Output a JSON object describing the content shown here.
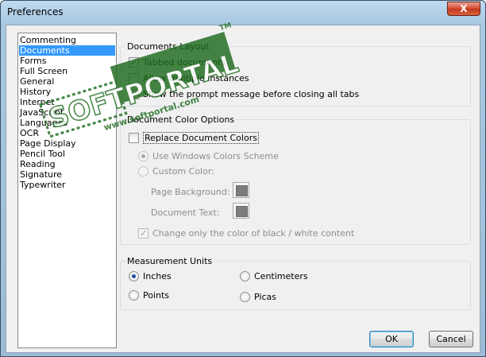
{
  "window": {
    "title": "Preferences",
    "close_symbol": "X"
  },
  "categories": [
    "Commenting",
    "Documents",
    "Forms",
    "Full Screen",
    "General",
    "History",
    "Internet",
    "JavaScript",
    "Languages",
    "OCR",
    "Page Display",
    "Pencil Tool",
    "Reading",
    "Signature",
    "Typewriter"
  ],
  "selected_category": "Documents",
  "document_layout": {
    "title": "Documents Layout",
    "tabbed": {
      "label": "Tabbed documents",
      "checked": true
    },
    "multiple": {
      "label": "Allow multiple instances",
      "checked": false
    },
    "prompt": {
      "label": "Show the prompt message before closing all tabs",
      "checked": false
    }
  },
  "color_options": {
    "title": "Document Color Options",
    "replace": {
      "label": "Replace Document Colors",
      "checked": false
    },
    "windows_scheme": {
      "label": "Use Windows Colors Scheme",
      "checked": true,
      "enabled": false
    },
    "custom": {
      "label": "Custom Color:",
      "checked": false,
      "enabled": false
    },
    "page_background": "Page Background:",
    "document_text": "Document Text:",
    "change_only": {
      "label": "Change only  the color of black / white content",
      "checked": true,
      "enabled": false
    }
  },
  "measurement": {
    "title": "Measurement Units",
    "inches": {
      "label": "Inches",
      "checked": true
    },
    "centimeters": {
      "label": "Centimeters",
      "checked": false
    },
    "points": {
      "label": "Points",
      "checked": false
    },
    "picas": {
      "label": "Picas",
      "checked": false
    }
  },
  "buttons": {
    "ok": "OK",
    "cancel": "Cancel"
  },
  "watermark": {
    "brand": "SOFTPORTAL",
    "tm": "TM",
    "url": "www.softportal.com"
  },
  "colors": {
    "selection": "#3399ff",
    "watermark": "#1e6b1e"
  }
}
